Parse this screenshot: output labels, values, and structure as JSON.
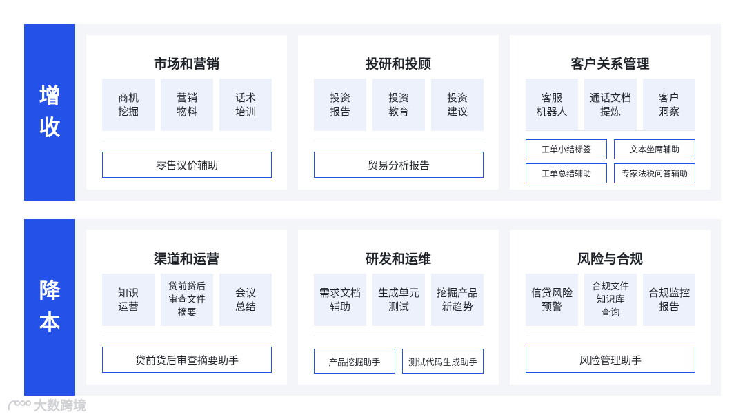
{
  "top_section": {
    "label_line1": "增",
    "label_line2": "收",
    "panels": [
      {
        "title": "市场和营销",
        "tiles": [
          {
            "line1": "商机",
            "line2": "挖掘"
          },
          {
            "line1": "营销",
            "line2": "物料"
          },
          {
            "line1": "话术",
            "line2": "培训"
          }
        ],
        "buttons": [
          "零售议价辅助"
        ]
      },
      {
        "title": "投研和投顾",
        "tiles": [
          {
            "line1": "投资",
            "line2": "报告"
          },
          {
            "line1": "投资",
            "line2": "教育"
          },
          {
            "line1": "投资",
            "line2": "建议"
          }
        ],
        "buttons": [
          "贸易分析报告"
        ]
      },
      {
        "title": "客户关系管理",
        "tiles": [
          {
            "line1": "客服",
            "line2": "机器人"
          },
          {
            "line1": "通话文档",
            "line2": "提炼"
          },
          {
            "line1": "客户",
            "line2": "洞察"
          }
        ],
        "buttons": [
          "工单小结标签",
          "文本坐席辅助",
          "工单总结辅助",
          "专家法税问答辅助"
        ]
      }
    ]
  },
  "bottom_section": {
    "label_line1": "降",
    "label_line2": "本",
    "panels": [
      {
        "title": "渠道和运营",
        "tiles": [
          {
            "line1": "知识",
            "line2": "运营"
          },
          {
            "line1": "贷前贷后",
            "line2": "审查文件",
            "line3": "摘要"
          },
          {
            "line1": "会议",
            "line2": "总结"
          }
        ],
        "buttons": [
          "贷前货后审查摘要助手"
        ]
      },
      {
        "title": "研发和运维",
        "tiles": [
          {
            "line1": "需求文档",
            "line2": "辅助"
          },
          {
            "line1": "生成单元",
            "line2": "测试"
          },
          {
            "line1": "挖掘产品",
            "line2": "新趋势"
          }
        ],
        "buttons": [
          "产品挖掘助手",
          "测试代码生成助手"
        ]
      },
      {
        "title": "风险与合规",
        "tiles": [
          {
            "line1": "信贷风险",
            "line2": "预警"
          },
          {
            "line1": "合规文件",
            "line2": "知识库",
            "line3": "查询"
          },
          {
            "line1": "合规监控",
            "line2": "报告"
          }
        ],
        "buttons": [
          "风险管理助手"
        ]
      }
    ]
  },
  "watermark": {
    "text": "大数跨境"
  },
  "colors": {
    "accent": "#2451e8",
    "band": "#f3f5f9",
    "tile": "#edf1fb"
  }
}
